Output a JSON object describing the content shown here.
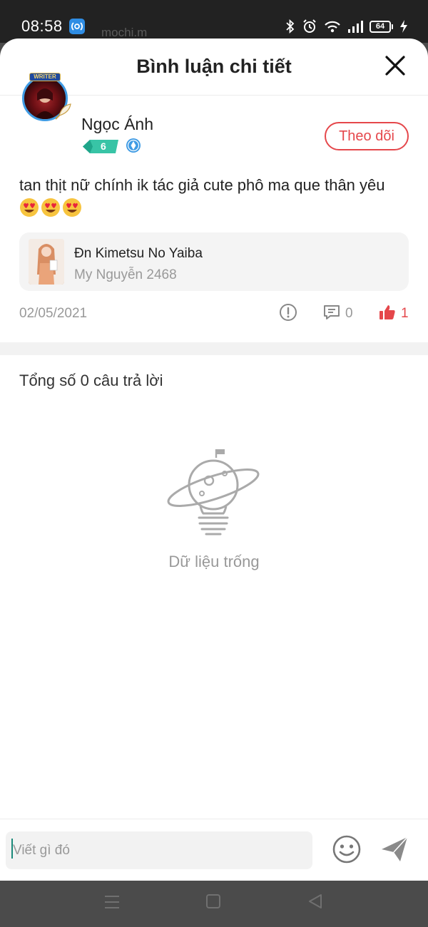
{
  "status_bar": {
    "time": "08:58",
    "ghost_text": "mochi.m",
    "battery": "64",
    "icons": [
      "app-notification-icon",
      "bluetooth-icon",
      "alarm-icon",
      "wifi-icon",
      "signal-icon",
      "battery-icon",
      "charging-icon"
    ]
  },
  "header": {
    "title": "Bình luận chi tiết",
    "close_icon": "close-icon"
  },
  "comment": {
    "username": "Ngọc Ánh",
    "avatar_badge": "WRITER",
    "level": "6",
    "follow_label": "Theo dõi",
    "text": "tan thịt nữ chính ik tác giả cute phô ma que thân yêu",
    "emojis": [
      "heart-eyes-emoji",
      "heart-eyes-emoji",
      "heart-eyes-emoji"
    ],
    "story": {
      "title": "Đn Kimetsu No Yaiba",
      "author": "My Nguyễn 2468"
    },
    "date": "02/05/2021",
    "reply_count": "0",
    "like_count": "1"
  },
  "replies": {
    "total_label": "Tổng số 0 câu trả lời",
    "empty_label": "Dữ liệu trống"
  },
  "input": {
    "placeholder": "Viết gì đó",
    "value": ""
  },
  "colors": {
    "accent_red": "#e5474b",
    "muted_text": "#999999",
    "primary_text": "#222222",
    "verify_blue": "#3f9be4",
    "level_teal": "#38c4a6"
  }
}
